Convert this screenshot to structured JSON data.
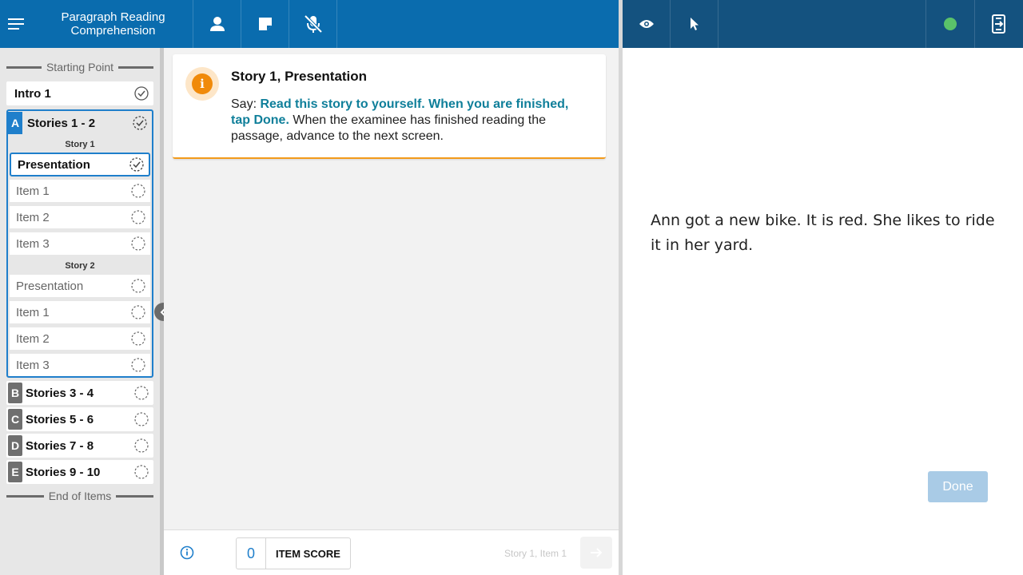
{
  "header": {
    "title_line1": "Paragraph Reading",
    "title_line2": "Comprehension",
    "icons": {
      "menu": "menu-icon",
      "examinee": "person-icon",
      "notes": "note-icon",
      "mic": "mic-off-icon",
      "eye": "eye-icon",
      "pointer": "pointer-icon",
      "status": "status-dot-icon",
      "exit": "exit-icon"
    },
    "status_color": "#5ac26a"
  },
  "sidebar": {
    "start_label": "Starting Point",
    "end_label": "End of Items",
    "intro": {
      "label": "Intro 1"
    },
    "group_a": {
      "badge": "A",
      "label": "Stories 1 - 2",
      "story1_label": "Story 1",
      "story2_label": "Story 2",
      "story1_items": [
        {
          "label": "Presentation"
        },
        {
          "label": "Item 1"
        },
        {
          "label": "Item 2"
        },
        {
          "label": "Item 3"
        }
      ],
      "story2_items": [
        {
          "label": "Presentation"
        },
        {
          "label": "Item 1"
        },
        {
          "label": "Item 2"
        },
        {
          "label": "Item 3"
        }
      ]
    },
    "groups": [
      {
        "badge": "B",
        "label": "Stories 3 - 4"
      },
      {
        "badge": "C",
        "label": "Stories 5 - 6"
      },
      {
        "badge": "D",
        "label": "Stories 7 - 8"
      },
      {
        "badge": "E",
        "label": "Stories 9 - 10"
      }
    ]
  },
  "card": {
    "title": "Story 1, Presentation",
    "say_prefix": "Say: ",
    "say_text": "Read this story to yourself. When you are finished, tap Done.",
    "instruction": " When the examinee has finished reading the passage, advance to the next screen."
  },
  "footer": {
    "score_value": "0",
    "score_label": "ITEM SCORE",
    "breadcrumb": "Story 1, Item 1"
  },
  "stimulus": {
    "text": "Ann got a new bike. It is red. She likes to ride it in her yard.",
    "done_label": "Done"
  },
  "colors": {
    "header_left": "#0a6cae",
    "header_right": "#14527f",
    "accent": "#1f7fcb",
    "say_text": "#0f7f9a",
    "info_orange": "#f08a0a"
  }
}
